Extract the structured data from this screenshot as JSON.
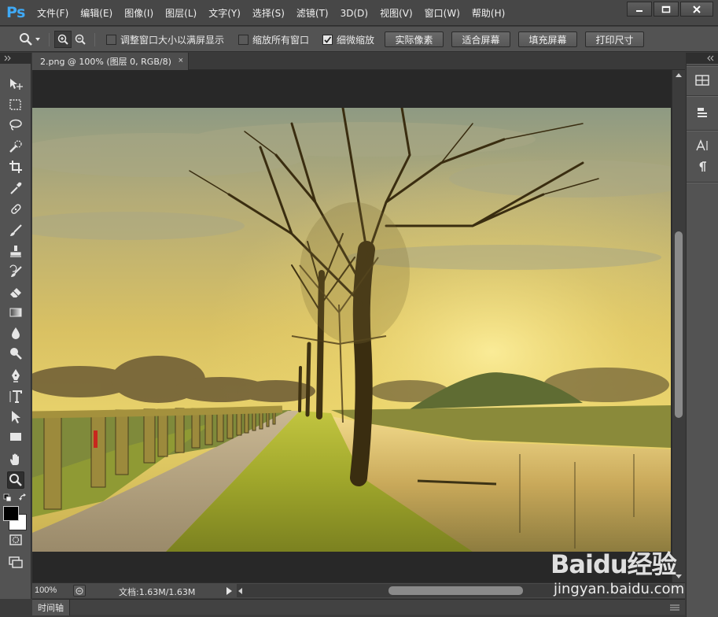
{
  "app": {
    "logo": "Ps"
  },
  "menu": {
    "items": [
      "文件(F)",
      "编辑(E)",
      "图像(I)",
      "图层(L)",
      "文字(Y)",
      "选择(S)",
      "滤镜(T)",
      "3D(D)",
      "视图(V)",
      "窗口(W)",
      "帮助(H)"
    ]
  },
  "window_controls": [
    "minimize-icon",
    "maximize-icon",
    "close-icon"
  ],
  "options": {
    "tool_icon": "zoom-icon",
    "zoom_in_icon": "zoom-in-icon",
    "zoom_out_icon": "zoom-out-icon",
    "resize_windows": {
      "label": "调整窗口大小以满屏显示",
      "checked": false
    },
    "zoom_all": {
      "label": "缩放所有窗口",
      "checked": false
    },
    "scrubby_zoom": {
      "label": "细微缩放",
      "checked": true
    },
    "actual_pixels": "实际像素",
    "fit_screen": "适合屏幕",
    "fill_screen": "填充屏幕",
    "print_size": "打印尺寸"
  },
  "document": {
    "tab_title": "2.png @ 100% (图层 0, RGB/8)",
    "close_glyph": "×"
  },
  "tools": [
    "move-icon",
    "marquee-icon",
    "lasso-icon",
    "quick-selection-icon",
    "crop-icon",
    "eyedropper-icon",
    "healing-brush-icon",
    "brush-icon",
    "clone-stamp-icon",
    "history-brush-icon",
    "eraser-icon",
    "gradient-icon",
    "blur-icon",
    "dodge-icon",
    "pen-icon",
    "type-icon",
    "path-selection-icon",
    "rectangle-icon",
    "hand-icon",
    "zoom-icon",
    "swap-colors-icon",
    "foreground-color",
    "quick-mask-icon",
    "screen-mode-icon"
  ],
  "colors": {
    "foreground": "#000000",
    "background": "#ffffff",
    "ui_dark": "#282828",
    "ui_panel": "#535353",
    "accent": "#3fa9f5"
  },
  "status": {
    "zoom": "100%",
    "doc_info": "文档:1.63M/1.63M"
  },
  "timeline": {
    "label": "时间轴"
  },
  "right_panel": [
    "arrange-icon",
    "layers-icon",
    "character-icon",
    "paragraph-icon"
  ],
  "watermark": {
    "logo": "Baidu经验",
    "url": "jingyan.baidu.com"
  }
}
